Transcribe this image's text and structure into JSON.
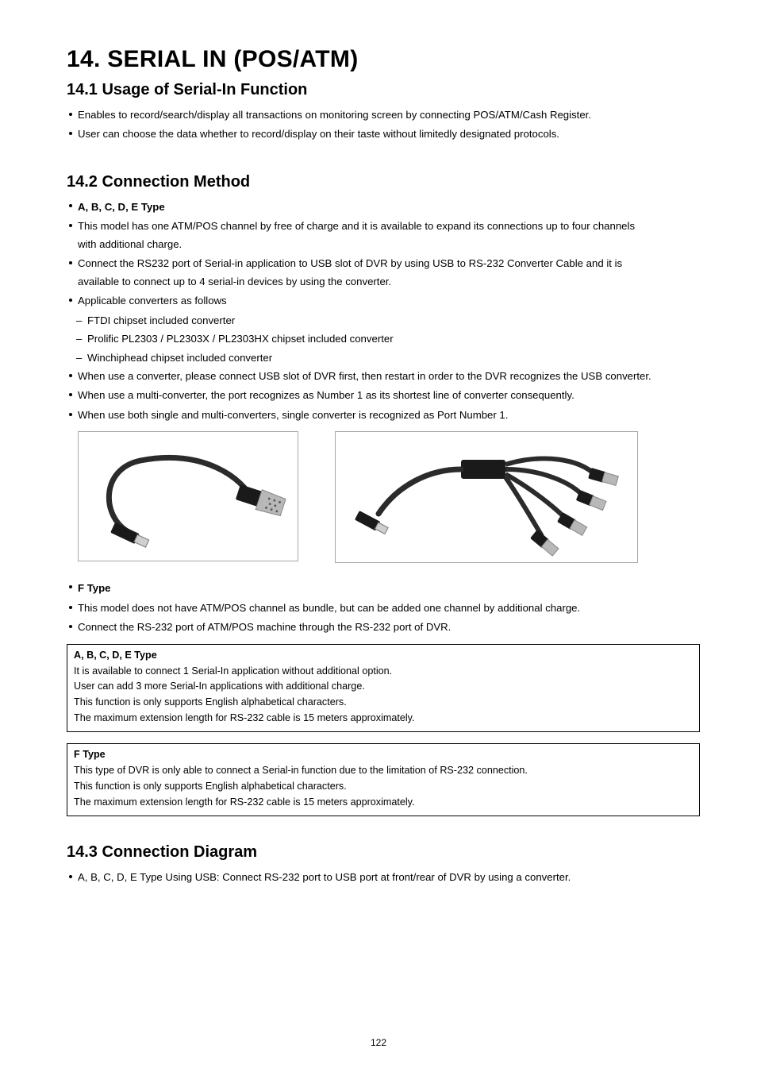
{
  "page": {
    "number": "122",
    "h1": "14.  SERIAL IN (POS/ATM)",
    "s141": {
      "heading": "14.1  Usage of Serial-In Function",
      "b1": "Enables to record/search/display all transactions on monitoring screen by connecting POS/ATM/Cash Register.",
      "b2": "User can choose the data whether to record/display on their taste without limitedly designated protocols."
    },
    "s142": {
      "heading": "14.2    Connection Method",
      "groupA": {
        "title": "A, B, C, D, E Type",
        "p1a": "This model has one ATM/POS channel by free of charge and it is available to expand its connections up to four channels",
        "p1b": "with additional charge.",
        "p2a": "Connect the RS232 port of Serial-in application to USB slot of DVR by using USB to RS-232 Converter Cable and it is",
        "p2b": "available to connect up to 4 serial-in devices by using the converter.",
        "p3": "Applicable converters as follows",
        "d1": "FTDI chipset included converter",
        "d2": "Prolific PL2303 / PL2303X / PL2303HX chipset included converter",
        "d3": "Winchiphead chipset included converter",
        "p4": "When use a converter, please connect USB slot of DVR first, then restart in order to the DVR recognizes the USB converter.",
        "p5": "When use a multi-converter, the port recognizes as Number 1 as its shortest line of converter consequently.",
        "p6": "When use both single and multi-converters, single converter is recognized as Port Number 1."
      },
      "groupF": {
        "title": "F Type",
        "p1": "This model does not have ATM/POS channel as bundle, but can be added one channel by additional charge.",
        "p2": "Connect the RS-232 port of ATM/POS machine through the RS-232 port of DVR."
      },
      "boxA": {
        "title": "A, B, C, D, E Type",
        "l1": "It is available to connect 1 Serial-In application without additional option.",
        "l2": "User can add 3 more Serial-In applications with additional charge.",
        "l3": "This function is only supports English alphabetical characters.",
        "l4": "The maximum extension length for RS-232 cable is 15 meters approximately."
      },
      "boxF": {
        "title": "F Type",
        "l1": "This type of DVR is only able to connect a Serial-in function due to the limitation of RS-232 connection.",
        "l2": "This function is only supports English alphabetical characters.",
        "l3": "The maximum extension length for RS-232 cable is 15 meters approximately."
      }
    },
    "s143": {
      "heading": "14.3    Connection Diagram",
      "b1": "A, B, C, D, E Type Using USB: Connect RS-232 port to USB port at front/rear of DVR by using a converter."
    }
  }
}
